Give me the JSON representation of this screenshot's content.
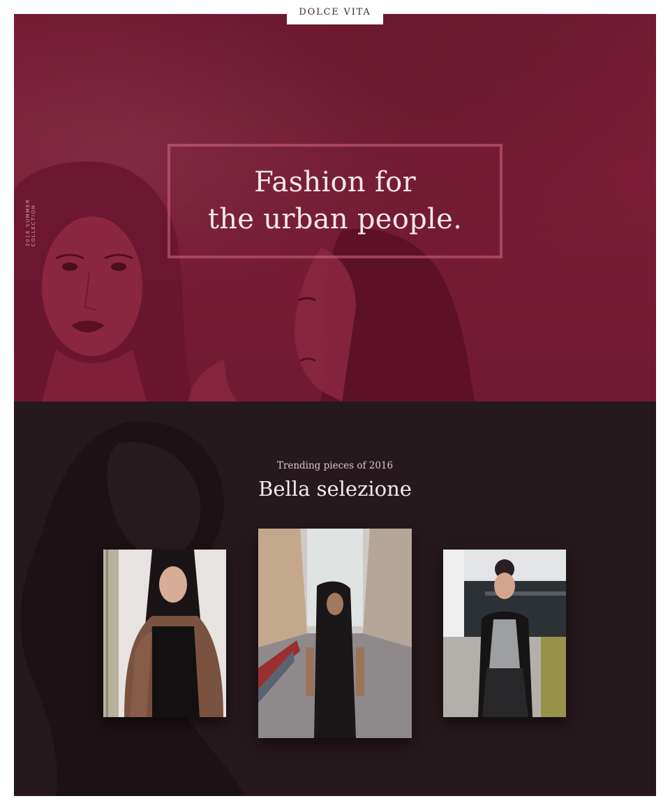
{
  "brand": {
    "name": "DOLCE VITA"
  },
  "hero": {
    "side_caption": "2016 Summer Collection",
    "headline_line1": "Fashion for",
    "headline_line2": "the urban people.",
    "background_color": "#7b1c37"
  },
  "selection": {
    "eyebrow": "Trending pieces of 2016",
    "title": "Bella selezione",
    "background_color": "#26191d",
    "cards": [
      {
        "icon": "photo-woman-fur-coat"
      },
      {
        "icon": "photo-man-street"
      },
      {
        "icon": "photo-woman-blazer"
      }
    ]
  }
}
